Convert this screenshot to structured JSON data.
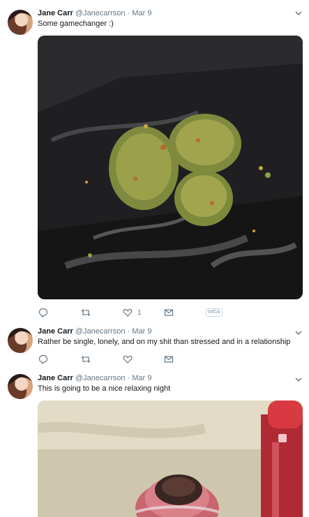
{
  "tweets": [
    {
      "name": "Jane Carr",
      "handle": "@Janecarrson",
      "separator": "·",
      "date": "Mar 9",
      "text": "Some gamechanger :)",
      "like_count": "1",
      "badge": "IMG&",
      "media": "photo of cannabis buds on black plastic"
    },
    {
      "name": "Jane Carr",
      "handle": "@Janecarrson",
      "separator": "·",
      "date": "Mar 9",
      "text": "Rather be single, lonely, and on my shit than stressed and in a relationship"
    },
    {
      "name": "Jane Carr",
      "handle": "@Janecarrson",
      "separator": "·",
      "date": "Mar 9",
      "text": "This is going to be a nice relaxing night",
      "media": "photo of glass pipe and red lighter"
    }
  ],
  "icons": [
    "reply-icon",
    "retweet-icon",
    "like-icon",
    "message-icon",
    "chevron-down-icon"
  ],
  "colors": {
    "name": "#14171a",
    "secondary": "#657786",
    "divider": "#e6ecf0"
  }
}
